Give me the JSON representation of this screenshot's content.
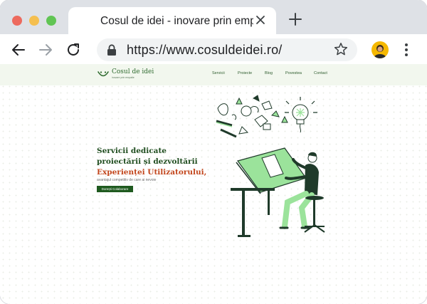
{
  "browser": {
    "tab_title": "Cosul de idei - inovare prin emp",
    "url": "https://www.cosuldeidei.ro/"
  },
  "site": {
    "logo_name": "Cosul de idei",
    "logo_tagline": "inovare prin empatie",
    "nav": [
      "Servicii",
      "Proiecte",
      "Blog",
      "Povestea",
      "Contact"
    ],
    "hero": {
      "line1": "Servicii dedicate",
      "line2": "proiectării și dezvoltării",
      "line3": "Experienței Utilizatorului,",
      "subtitle": "avantajul competitiv de care ai nevoie",
      "cta": "Dorești Colaborare"
    }
  },
  "colors": {
    "brand_green": "#1f5a1f",
    "accent_orange": "#c2461c",
    "header_bg": "#f2f7ee",
    "illustration_green": "#9be39b"
  },
  "icons": [
    "back-icon",
    "forward-icon",
    "reload-icon",
    "lock-icon",
    "star-icon",
    "menu-icon",
    "close-icon",
    "plus-icon"
  ]
}
